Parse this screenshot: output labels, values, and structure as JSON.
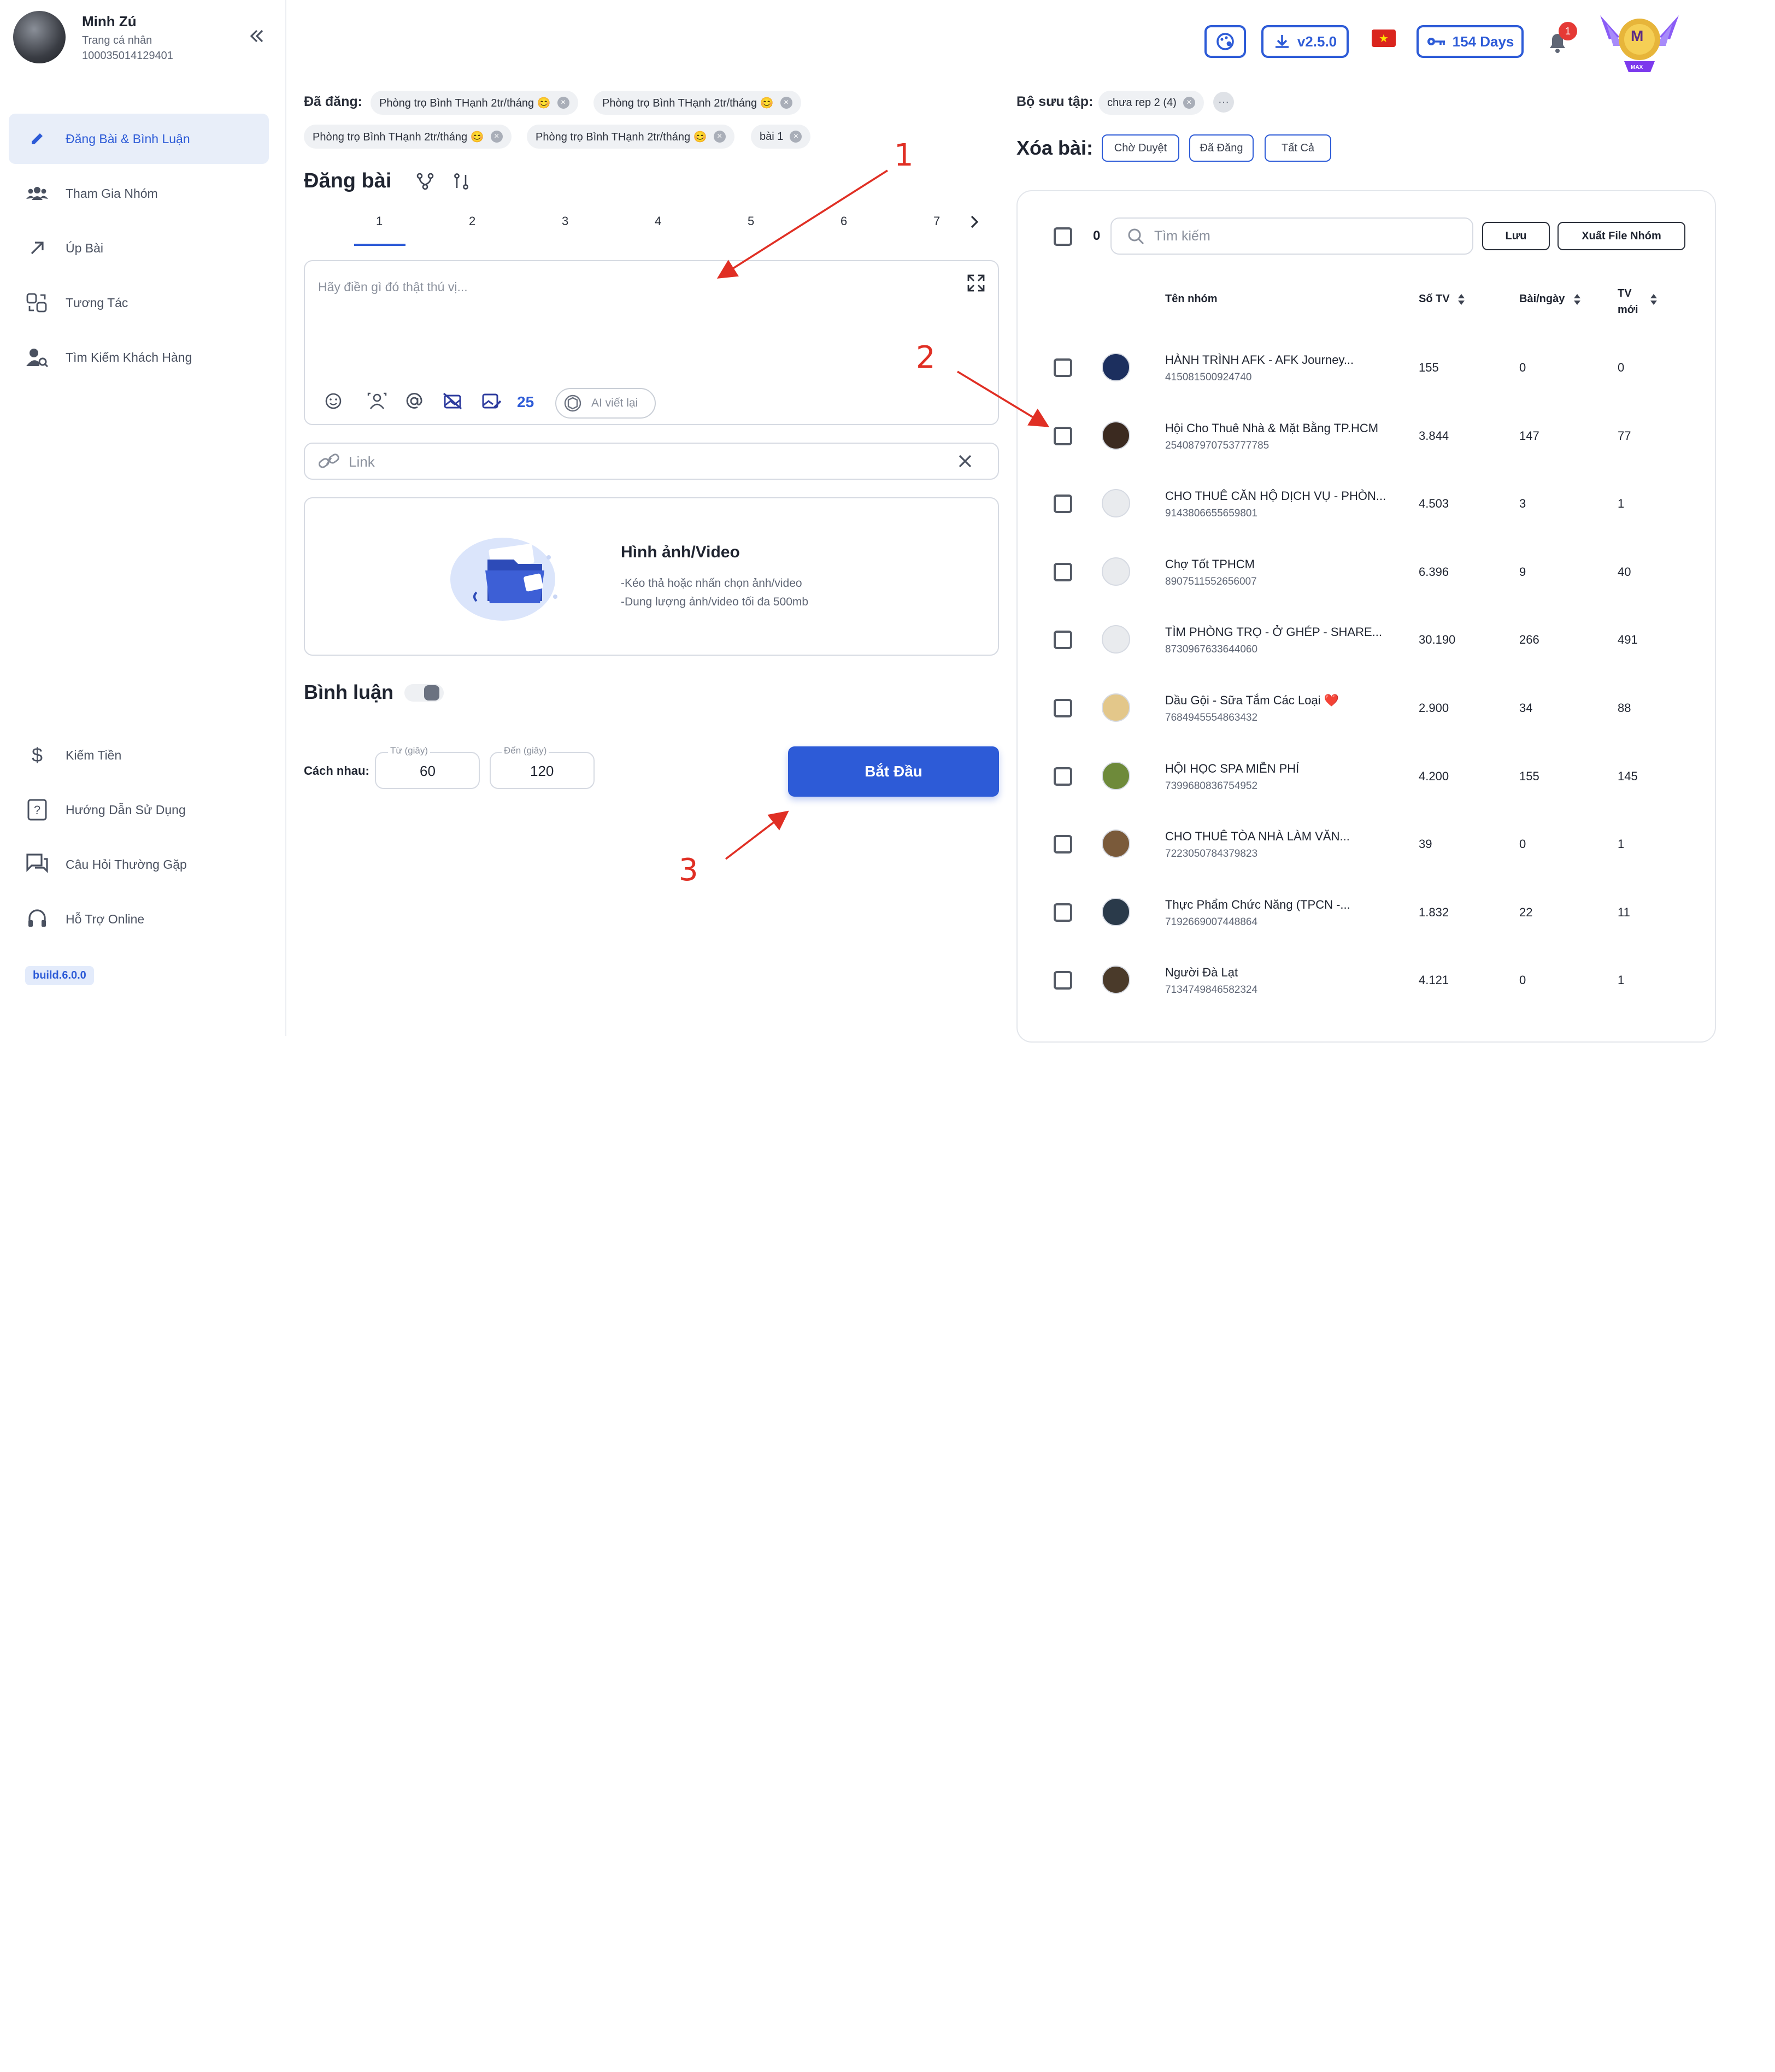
{
  "user": {
    "name": "Minh Zú",
    "subtitle": "Trang cá nhân",
    "id": "100035014129401"
  },
  "sidebar": {
    "items": [
      {
        "label": "Đăng Bài & Bình Luận",
        "icon": "pencil-icon",
        "active": true
      },
      {
        "label": "Tham Gia Nhóm",
        "icon": "group-icon"
      },
      {
        "label": "Úp Bài",
        "icon": "arrow-up-right-icon"
      },
      {
        "label": "Tương Tác",
        "icon": "interaction-icon"
      },
      {
        "label": "Tìm Kiếm Khách Hàng",
        "icon": "user-search-icon"
      }
    ],
    "bottom_items": [
      {
        "label": "Kiếm Tiền",
        "icon": "dollar-icon"
      },
      {
        "label": "Hướng Dẫn Sử Dụng",
        "icon": "guide-book-icon"
      },
      {
        "label": "Câu Hỏi Thường Gặp",
        "icon": "faq-icon"
      },
      {
        "label": "Hỗ Trợ Online",
        "icon": "headset-icon"
      }
    ],
    "build": "build.6.0.0"
  },
  "topbar": {
    "version": "v2.5.0",
    "days": "154 Days",
    "notifications": "1",
    "rank": "M",
    "rank_sub": "MAX"
  },
  "posted": {
    "label": "Đã đăng:",
    "chips": [
      "Phòng trọ Bình THạnh 2tr/tháng 😊",
      "Phòng trọ Bình THạnh 2tr/tháng 😊",
      "Phòng trọ Bình THạnh 2tr/tháng 😊",
      "Phòng trọ Bình THạnh 2tr/tháng 😊",
      "bài 1"
    ]
  },
  "composer": {
    "title": "Đăng bài",
    "tabs": [
      "1",
      "2",
      "3",
      "4",
      "5",
      "6",
      "7"
    ],
    "placeholder": "Hãy điền gì đó thật thú vị...",
    "counter": "25",
    "ai_label": "AI viết lại",
    "link_placeholder": "Link",
    "media_title": "Hình ảnh/Video",
    "media_line1": "-Kéo thả hoặc nhấn chọn ảnh/video",
    "media_line2": "-Dung lượng ảnh/video tối đa 500mb",
    "comment_label": "Bình luận",
    "interval_label": "Cách nhau:",
    "from_label": "Từ (giây)",
    "from_value": "60",
    "to_label": "Đến (giây)",
    "to_value": "120",
    "start_label": "Bắt Đầu"
  },
  "collection": {
    "label": "Bộ sưu tập:",
    "chip": "chưa rep 2 (4)"
  },
  "delete": {
    "label": "Xóa bài:",
    "buttons": [
      "Chờ Duyệt",
      "Đã Đăng",
      "Tất Cả"
    ]
  },
  "groups": {
    "selected_count": "0",
    "search_placeholder": "Tìm kiếm",
    "save_label": "Lưu",
    "export_label": "Xuất File Nhóm",
    "headers": {
      "name": "Tên nhóm",
      "members": "Số TV",
      "posts": "Bài/ngày",
      "new1": "TV",
      "new2": "mới"
    },
    "rows": [
      {
        "name": "HÀNH TRÌNH AFK - AFK Journey...",
        "id": "415081500924740",
        "members": "155",
        "posts": "0",
        "new": "0",
        "avatar": "#1c2f5e"
      },
      {
        "name": "Hội Cho Thuê Nhà & Mặt Bằng TP.HCM",
        "id": "254087970753777785",
        "members": "3.844",
        "posts": "147",
        "new": "77",
        "avatar": "#3b2a20"
      },
      {
        "name": "CHO THUÊ CĂN HỘ DỊCH VỤ - PHÒN...",
        "id": "9143806655659801",
        "members": "4.503",
        "posts": "3",
        "new": "1",
        "avatar": "#e9ebee"
      },
      {
        "name": "Chợ Tốt TPHCM",
        "id": "8907511552656007",
        "members": "6.396",
        "posts": "9",
        "new": "40",
        "avatar": "#e9ebee"
      },
      {
        "name": "TÌM PHÒNG TRỌ - Ở GHÉP - SHARE...",
        "id": "8730967633644060",
        "members": "30.190",
        "posts": "266",
        "new": "491",
        "avatar": "#e9ebee"
      },
      {
        "name": "Dầu Gội - Sữa Tắm Các Loại ❤️",
        "id": "7684945554863432",
        "members": "2.900",
        "posts": "34",
        "new": "88",
        "avatar": "#e3c78a"
      },
      {
        "name": "HỘI HỌC SPA MIỄN PHÍ",
        "id": "7399680836754952",
        "members": "4.200",
        "posts": "155",
        "new": "145",
        "avatar": "#6e8a3a"
      },
      {
        "name": "CHO THUÊ TÒA NHÀ LÀM VĂN...",
        "id": "7223050784379823",
        "members": "39",
        "posts": "0",
        "new": "1",
        "avatar": "#7a5a3a"
      },
      {
        "name": "Thực Phẩm Chức Năng (TPCN -...",
        "id": "7192669007448864",
        "members": "1.832",
        "posts": "22",
        "new": "11",
        "avatar": "#2a3a4a"
      },
      {
        "name": "Người Đà Lạt",
        "id": "7134749846582324",
        "members": "4.121",
        "posts": "0",
        "new": "1",
        "avatar": "#4a3a2a"
      }
    ]
  },
  "annotations": [
    "1",
    "2",
    "3"
  ],
  "colors": {
    "accent": "#2d5bd7",
    "arrow": "#e02f24"
  }
}
